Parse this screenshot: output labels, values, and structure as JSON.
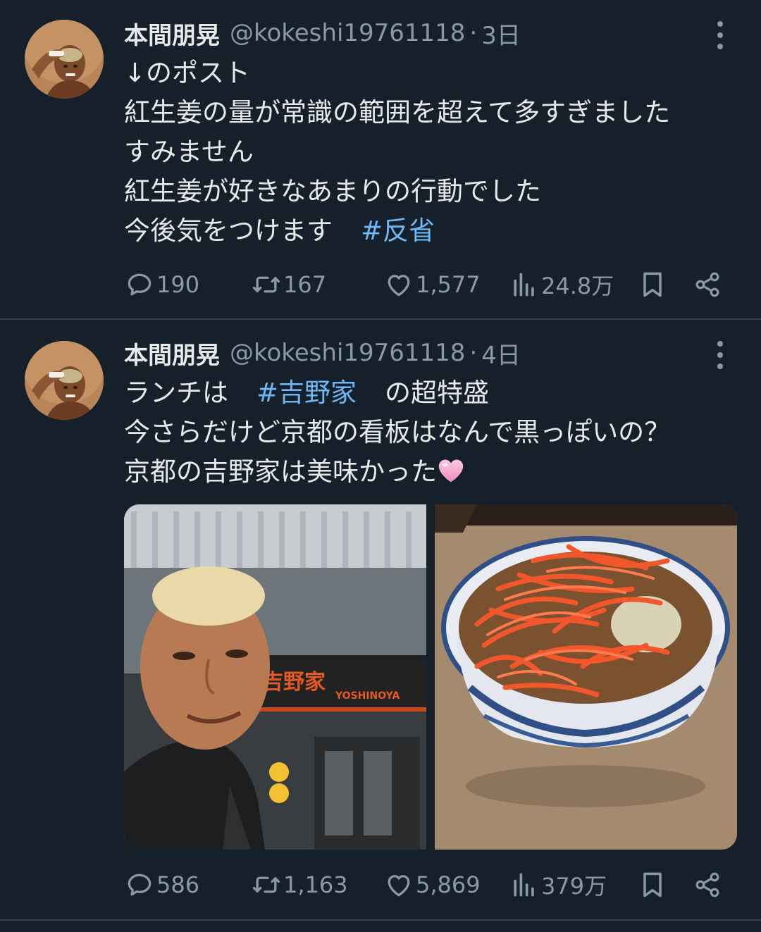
{
  "tweets": [
    {
      "author_name": "本間朋晃",
      "handle": "@kokeshi19761118",
      "separator": "·",
      "time": "3日",
      "lines": [
        "↓のポスト",
        "紅生姜の量が常識の範囲を超えて多すぎました",
        "すみません",
        "紅生姜が好きなあまりの行動でした",
        "今後気をつけます"
      ],
      "hashtag": "#反省",
      "stats": {
        "replies": "190",
        "retweets": "167",
        "likes": "1,577",
        "views": "24.8万"
      }
    },
    {
      "author_name": "本間朋晃",
      "handle": "@kokeshi19761118",
      "separator": "·",
      "time": "4日",
      "line1_prefix": "ランチは",
      "line1_hashtag": "#吉野家",
      "line1_suffix": "の超特盛",
      "line2": "今さらだけど京都の看板はなんで黒っぽいの？",
      "line3": "京都の吉野家は美味かった",
      "sign_text": "吉野家",
      "sign_subtext": "YOSHINOYA",
      "stats": {
        "replies": "586",
        "retweets": "1,163",
        "likes": "5,869",
        "views": "379万"
      }
    }
  ],
  "icons": {
    "avatar": "avatar",
    "more": "more-icon",
    "reply": "reply-icon",
    "retweet": "retweet-icon",
    "like": "heart-icon",
    "views": "views-icon",
    "bookmark": "bookmark-icon",
    "share": "share-icon",
    "emoji": "pink-heart-emoji"
  },
  "colors": {
    "background": "#15202b",
    "text": "#e7e9ea",
    "secondary": "#8b98a5",
    "hashtag": "#6eb7f5",
    "divider": "#38444d"
  }
}
